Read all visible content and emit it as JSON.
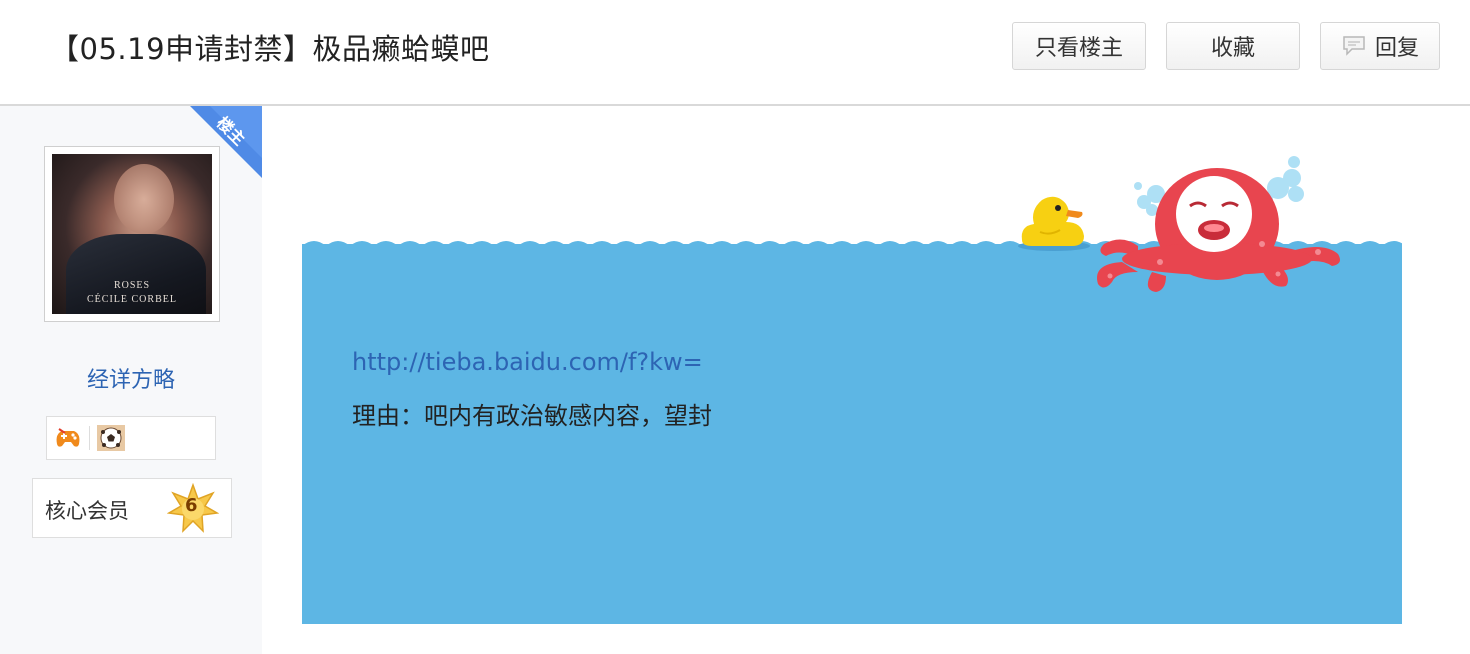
{
  "header": {
    "title": "【05.19申请封禁】极品癞蛤蟆吧",
    "only_op_label": "只看楼主",
    "favorite_label": "收藏",
    "reply_label": "回复"
  },
  "author": {
    "op_ribbon": "楼主",
    "avatar_caption_line1": "ROSES",
    "avatar_caption_line2": "CÉCILE CORBEL",
    "username": "经详方略",
    "level_title": "核心会员",
    "level_number": "6"
  },
  "post": {
    "link": "http://tieba.baidu.com/f?kw=",
    "reason": "理由：吧内有政治敏感内容，望封"
  },
  "colors": {
    "water": "#5db6e4",
    "link": "#2d64b3",
    "ribbon": "#4f8ae6"
  }
}
